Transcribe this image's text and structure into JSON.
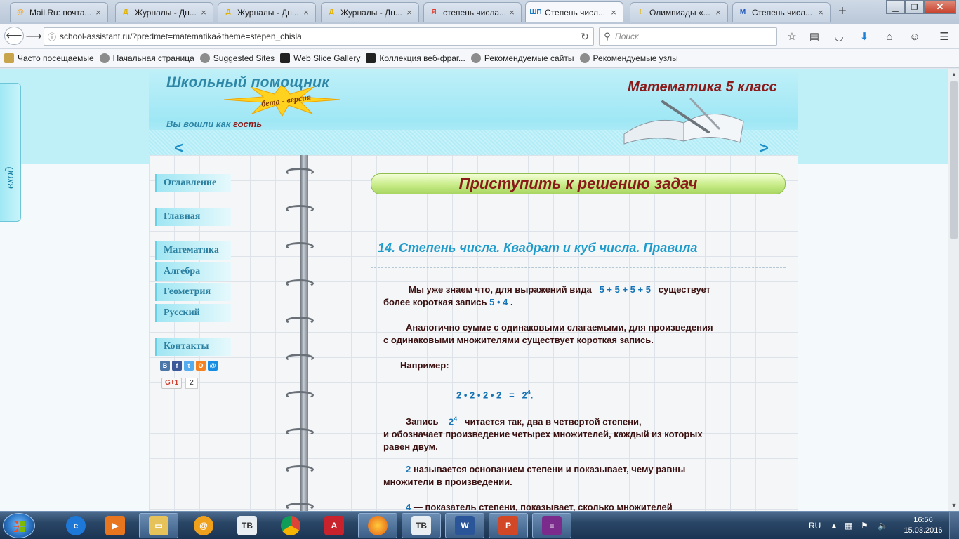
{
  "browser": {
    "tabs": [
      {
        "title": "Mail.Ru: почта...",
        "icon": "mailru-icon",
        "color": "#f5a623"
      },
      {
        "title": "Журналы - Дн...",
        "icon": "dnevnik-icon",
        "color": "#e3b200"
      },
      {
        "title": "Журналы - Дн...",
        "icon": "dnevnik-icon",
        "color": "#e3b200"
      },
      {
        "title": "Журналы - Дн...",
        "icon": "dnevnik-icon",
        "color": "#e3b200"
      },
      {
        "title": "степень числа...",
        "icon": "yandex-icon",
        "color": "#e03a2a"
      },
      {
        "title": "Степень числ...",
        "icon": "shp-icon",
        "color": "#1a78c2"
      },
      {
        "title": "Олимпиады «...",
        "icon": "olympiad-icon",
        "color": "#e3b200"
      },
      {
        "title": "Степень числ...",
        "icon": "m-icon",
        "color": "#1a55b8"
      }
    ],
    "url": "school-assistant.ru/?predmet=matematika&theme=stepen_chisla",
    "search_placeholder": "Поиск",
    "bookmarks": [
      "Часто посещаемые",
      "Начальная страница",
      "Suggested Sites",
      "Web Slice Gallery",
      "Коллекция веб-фраг...",
      "Рекомендуемые сайты",
      "Рекомендуемые узлы"
    ]
  },
  "page": {
    "login_tab": "вход",
    "logo": "Школьный помощник",
    "beta": "бета - версия",
    "guest_prefix": "Вы вошли как",
    "guest_name": "гость",
    "subject": "Математика 5 класс",
    "arrow_left": "<",
    "arrow_right": ">",
    "menu": [
      "Оглавление",
      "Главная",
      "Математика",
      "Алгебра",
      "Геометрия",
      "Русский",
      "Контакты"
    ],
    "social": [
      {
        "label": "В",
        "color": "#4a76a8"
      },
      {
        "label": "f",
        "color": "#3b5998"
      },
      {
        "label": "t",
        "color": "#55acee"
      },
      {
        "label": "О",
        "color": "#f58220"
      },
      {
        "label": "@",
        "color": "#168de2"
      }
    ],
    "gplus": "G+1",
    "gplus_count": "2",
    "cta": "Приступить к решению задач",
    "topic_title": "14. Степень числа. Квадрат и куб числа. Правила",
    "p1a": "Мы уже знаем что, для выражений вида",
    "p1_expr": "5 + 5 + 5 + 5",
    "p1b": "существует",
    "p1c": "более короткая запись",
    "p1_short": "5 • 4",
    "p1_end": ".",
    "p2a": "Аналогично сумме с одинаковыми слагаемыми, для произведения",
    "p2b": "с одинаковыми множителями существует короткая запись.",
    "p3": "Например:",
    "formula_left": "2 • 2 • 2 • 2",
    "formula_eq": "=",
    "formula_base": "2",
    "formula_exp": "4",
    "formula_end": ".",
    "p4a": "Запись",
    "p4_base": "2",
    "p4_exp": "4",
    "p4b": "читается так, два в четвертой степени,",
    "p4c": "и обозначает произведение четырех множителей, каждый из которых",
    "p4d": "равен двум.",
    "p5_base": "2",
    "p5a": "называется основанием степени и показывает, чему равны",
    "p5b": "множители в произведении.",
    "p6_exp": "4",
    "p6a": "— показатель степени, показывает, сколько множителей"
  },
  "taskbar": {
    "language": "RU",
    "time": "16:56",
    "date": "15.03.2016"
  }
}
